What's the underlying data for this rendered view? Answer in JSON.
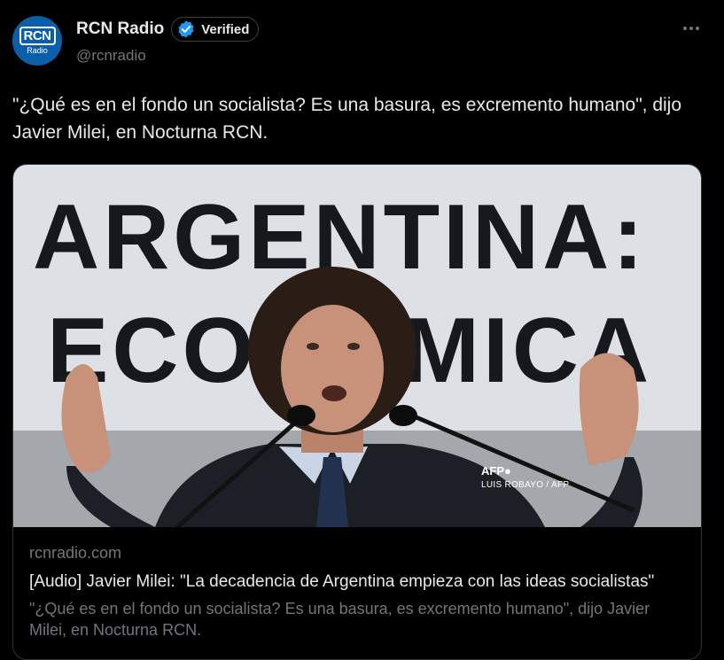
{
  "author": {
    "display_name": "RCN Radio",
    "handle": "@rcnradio",
    "verified_label": "Verified",
    "avatar_logo": "RCN",
    "avatar_sub": "Radio",
    "avatar_color": "#0b5fa8"
  },
  "menu": {
    "icon": "more-horizontal-icon"
  },
  "tweet": {
    "text": "\"¿Qué es en el fondo un socialista? Es una basura, es excremento humano\", dijo Javier Milei, en Nocturna RCN."
  },
  "card": {
    "image": {
      "banner_line1": "ARGENTINA:",
      "banner_line2": "ECONÓMICA",
      "credit_logo": "AFP●",
      "credit_text": "LUIS ROBAYO / AFP"
    },
    "domain": "rcnradio.com",
    "title": "[Audio] Javier Milei: \"La decadencia de Argentina empieza con las ideas socialistas\"",
    "description": "\"¿Qué es en el fondo un socialista? Es una basura, es excremento humano\", dijo Javier Milei, en Nocturna RCN."
  },
  "colors": {
    "background": "#000000",
    "primary_text": "#e7e9ea",
    "secondary_text": "#71767b",
    "verified_blue": "#1d9bf0",
    "border": "#2f3336"
  }
}
